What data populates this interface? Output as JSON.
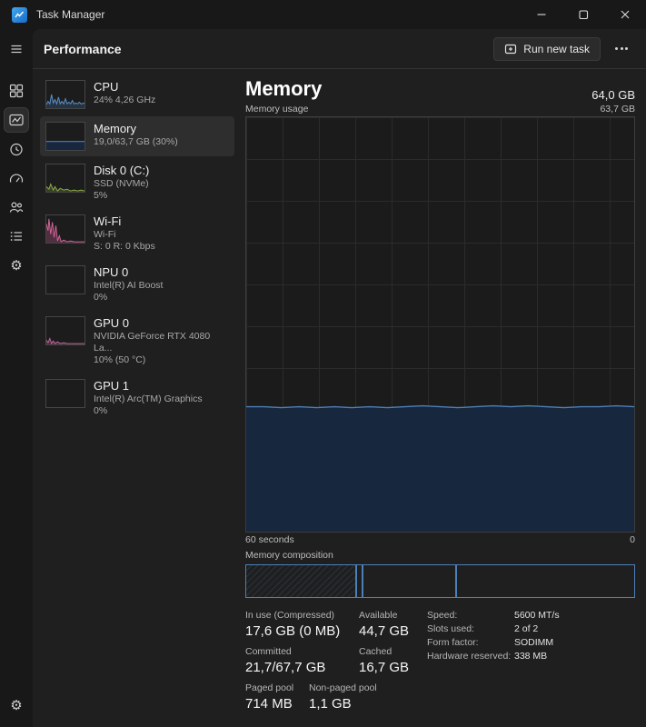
{
  "window": {
    "title": "Task Manager"
  },
  "header": {
    "title": "Performance",
    "run_new_task_label": "Run new task"
  },
  "icons": {
    "gear": "⚙"
  },
  "colors": {
    "accent": "#4d7fb8",
    "chart_fill": "#16273e",
    "selected_bg": "#2e2e2e"
  },
  "sidebar": {
    "items": [
      {
        "name": "CPU",
        "line2": "24% 4,26 GHz"
      },
      {
        "name": "Memory",
        "line2": "19,0/63,7 GB (30%)"
      },
      {
        "name": "Disk 0 (C:)",
        "line2": "SSD (NVMe)",
        "line3": "5%"
      },
      {
        "name": "Wi-Fi",
        "line2": "Wi-Fi",
        "line3": "S: 0 R: 0 Kbps"
      },
      {
        "name": "NPU 0",
        "line2": "Intel(R) AI Boost",
        "line3": "0%"
      },
      {
        "name": "GPU 0",
        "line2": "NVIDIA GeForce RTX 4080 La...",
        "line3": "10% (50 °C)"
      },
      {
        "name": "GPU 1",
        "line2": "Intel(R) Arc(TM) Graphics",
        "line3": "0%"
      }
    ]
  },
  "main": {
    "title": "Memory",
    "capacity": "64,0 GB",
    "usage_label": "Memory usage",
    "usage_scale_top": "63,7 GB",
    "time_axis_left": "60 seconds",
    "time_axis_right": "0",
    "composition_label": "Memory composition",
    "stats": {
      "in_use_label": "In use (Compressed)",
      "in_use_value": "17,6 GB (0 MB)",
      "available_label": "Available",
      "available_value": "44,7 GB",
      "committed_label": "Committed",
      "committed_value": "21,7/67,7 GB",
      "cached_label": "Cached",
      "cached_value": "16,7 GB",
      "paged_label": "Paged pool",
      "paged_value": "714 MB",
      "nonpaged_label": "Non-paged pool",
      "nonpaged_value": "1,1 GB"
    },
    "details": [
      {
        "label": "Speed:",
        "value": "5600 MT/s"
      },
      {
        "label": "Slots used:",
        "value": "2 of 2"
      },
      {
        "label": "Form factor:",
        "value": "SODIMM"
      },
      {
        "label": "Hardware reserved:",
        "value": "338 MB"
      }
    ]
  }
}
